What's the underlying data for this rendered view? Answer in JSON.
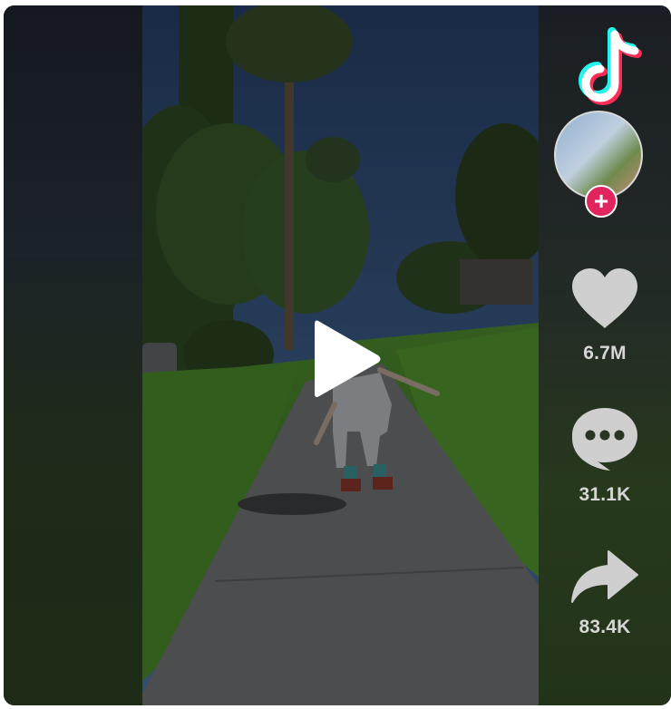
{
  "player": {
    "state": "paused",
    "play_icon": "play-icon"
  },
  "brand": {
    "logo_icon": "tiktok-logo-icon",
    "colors": {
      "cyan": "#25f4ee",
      "pink": "#fe2c55",
      "white": "#ffffff"
    }
  },
  "creator": {
    "avatar": "creator-avatar",
    "follow_symbol": "+",
    "follow_color": "#e0245e"
  },
  "actions": {
    "likes": {
      "icon": "heart-icon",
      "count": "6.7M"
    },
    "comments": {
      "icon": "comment-icon",
      "count": "31.1K"
    },
    "shares": {
      "icon": "share-icon",
      "count": "83.4K"
    }
  }
}
